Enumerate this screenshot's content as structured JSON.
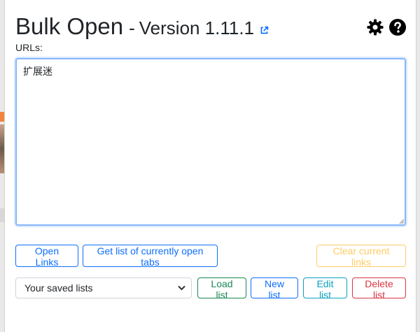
{
  "header": {
    "title": "Bulk Open",
    "separator": "-",
    "version": "Version 1.11.1",
    "icons": [
      "external-link-icon",
      "gear-icon",
      "question-circle-icon"
    ]
  },
  "urls": {
    "label": "URLs:",
    "value": "扩展迷"
  },
  "actions": {
    "open_links": "Open Links",
    "get_tabs": "Get list of currently open tabs",
    "clear": "Clear current links"
  },
  "saved": {
    "select_value": "Your saved lists",
    "load": "Load list",
    "new": "New list",
    "edit": "Edit list",
    "delete": "Delete list"
  },
  "colors": {
    "primary": "#0d6efd",
    "warning": "#ffcc66",
    "success": "#198754",
    "info": "#0aa2c0",
    "danger": "#dc3545"
  }
}
